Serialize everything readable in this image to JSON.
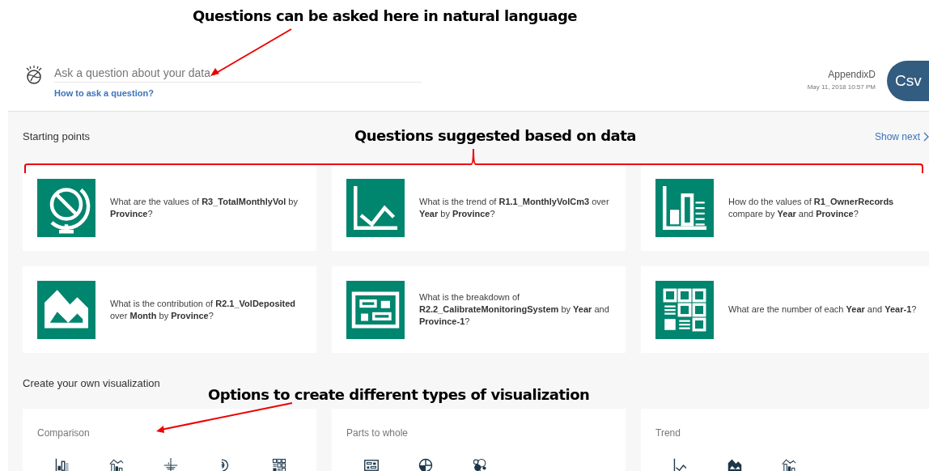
{
  "annotations": [
    {
      "kind": "arrow",
      "text": "Questions can be asked here in natural language"
    },
    {
      "kind": "bracket",
      "text": "Questions suggested based on data"
    },
    {
      "kind": "arrow2",
      "text": "Options to create different types of visualization"
    }
  ],
  "search": {
    "placeholder": "Ask a question about your data",
    "help_link": "How to ask a question?"
  },
  "user": {
    "name": "AppendixD",
    "timestamp": "May 11, 2018 10:57 PM",
    "avatar": "Csv"
  },
  "starting_points": {
    "title": "Starting points",
    "show_next": "Show next",
    "cards": [
      {
        "kind": "globe",
        "text": "What are the values of **R3_TotalMonthlyVol** by **Province**?"
      },
      {
        "kind": "line",
        "text": "What is the trend of **R1.1_MonthlyVolCm3** over **Year** by **Province**?"
      },
      {
        "kind": "bar",
        "text": "How do the values of **R1_OwnerRecords** compare by **Year** and **Province**?"
      },
      {
        "kind": "area",
        "text": "What is the contribution of **R2.1_VolDeposited** over **Month** by **Province**?"
      },
      {
        "kind": "layout",
        "text": "What is the breakdown of **R2.2_CalibrateMonitoringSystem** by **Year** and **Province-1**?"
      },
      {
        "kind": "grid",
        "text": "What are the number of each **Year** and **Year-1**?"
      }
    ]
  },
  "create": {
    "title": "Create your own visualization",
    "groups": [
      {
        "title": "Comparison",
        "options": [
          {
            "kind": "bar"
          },
          {
            "kind": "barline"
          },
          {
            "kind": "bullet"
          },
          {
            "kind": "radial"
          },
          {
            "kind": "grid"
          }
        ]
      },
      {
        "title": "Parts to whole",
        "options": [
          {
            "kind": "layout"
          },
          {
            "kind": "pie"
          },
          {
            "kind": "bubbles"
          }
        ]
      },
      {
        "title": "Trend",
        "options": [
          {
            "kind": "line"
          },
          {
            "kind": "area"
          },
          {
            "kind": "barline"
          }
        ]
      }
    ]
  }
}
